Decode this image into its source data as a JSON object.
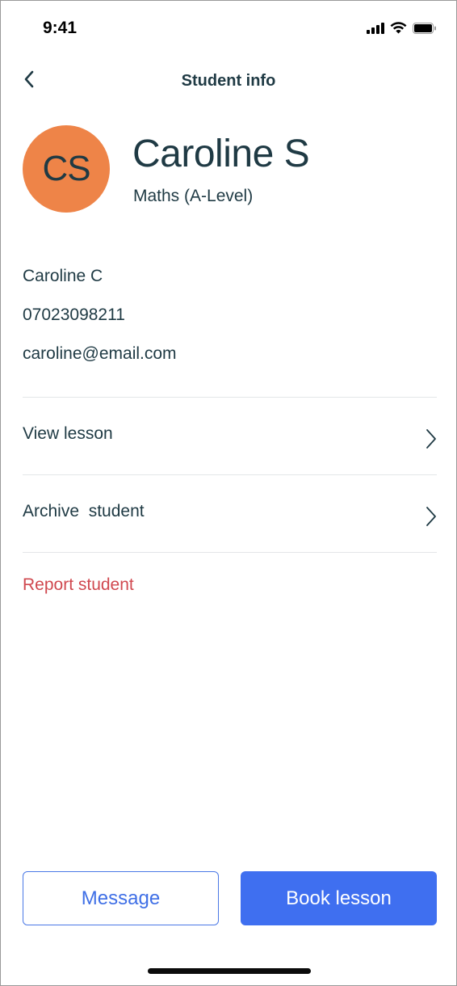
{
  "status_bar": {
    "time": "9:41",
    "icons": [
      "cellular-signal-icon",
      "wifi-icon",
      "battery-icon"
    ]
  },
  "header": {
    "back_icon": "chevron-left-icon",
    "title": "Student info"
  },
  "profile": {
    "initials": "CS",
    "name": "Caroline S",
    "subject": "Maths (A-Level)",
    "avatar_color": "#ee8448"
  },
  "contact": {
    "parent_name": "Caroline C",
    "phone": "07023098211",
    "email": "caroline@email.com"
  },
  "actions": {
    "view_lesson": "View lesson",
    "archive_student": "Archive  student",
    "report_student": "Report student",
    "chevron_icon": "chevron-right-icon"
  },
  "buttons": {
    "message": "Message",
    "book_lesson": "Book lesson"
  },
  "colors": {
    "text": "#1f3a44",
    "accent": "#3f6ff0",
    "danger": "#d0484f",
    "divider": "#e4e6e8"
  }
}
